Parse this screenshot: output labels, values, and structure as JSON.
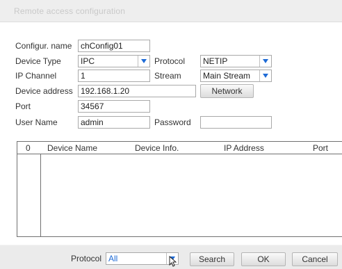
{
  "dialog": {
    "title": "Remote access configuration"
  },
  "form": {
    "config_name": {
      "label": "Configur. name",
      "value": "chConfig01"
    },
    "device_type": {
      "label": "Device Type",
      "value": "IPC"
    },
    "protocol": {
      "label": "Protocol",
      "value": "NETIP"
    },
    "ip_channel": {
      "label": "IP Channel",
      "value": "1"
    },
    "stream": {
      "label": "Stream",
      "value": "Main Stream"
    },
    "device_address": {
      "label": "Device address",
      "value": "192.168.1.20"
    },
    "network_button": "Network",
    "port": {
      "label": "Port",
      "value": "34567"
    },
    "user_name": {
      "label": "User Name",
      "value": "admin"
    },
    "password": {
      "label": "Password",
      "value": ""
    }
  },
  "table": {
    "columns": [
      "0",
      "Device Name",
      "Device Info.",
      "IP Address",
      "Port"
    ],
    "rows": []
  },
  "footer": {
    "protocol_label": "Protocol",
    "protocol_value": "All",
    "search_button": "Search",
    "ok_button": "OK",
    "cancel_button": "Cancel"
  },
  "colors": {
    "dropdown_arrow": "#1e6bd6",
    "selected_text": "#1e6bd6"
  }
}
